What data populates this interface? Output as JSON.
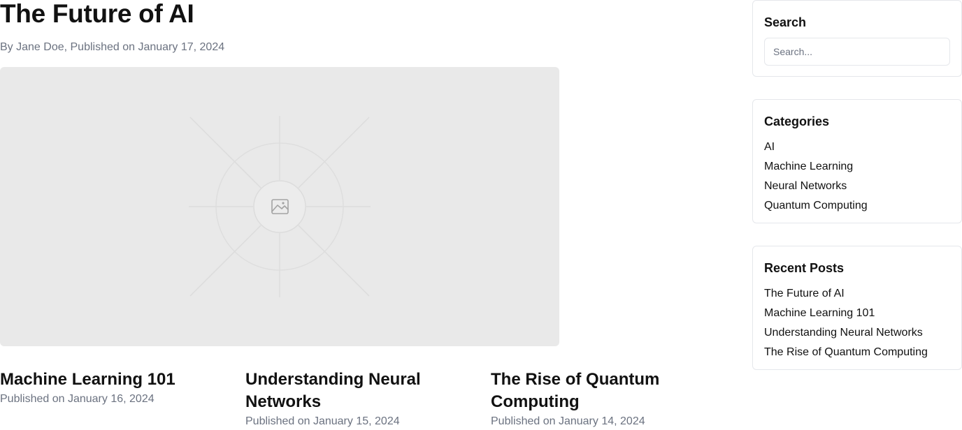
{
  "post": {
    "title": "The Future of AI",
    "byline": "By Jane Doe, Published on January 17, 2024",
    "image_icon": "image-placeholder-icon"
  },
  "related_posts": [
    {
      "title": "Machine Learning 101",
      "date": "Published on January 16, 2024"
    },
    {
      "title": "Understanding Neural Networks",
      "date": "Published on January 15, 2024"
    },
    {
      "title": "The Rise of Quantum Computing",
      "date": "Published on January 14, 2024"
    }
  ],
  "sidebar": {
    "search": {
      "title": "Search",
      "placeholder": "Search..."
    },
    "categories": {
      "title": "Categories",
      "items": [
        "AI",
        "Machine Learning",
        "Neural Networks",
        "Quantum Computing"
      ]
    },
    "recent": {
      "title": "Recent Posts",
      "items": [
        "The Future of AI",
        "Machine Learning 101",
        "Understanding Neural Networks",
        "The Rise of Quantum Computing"
      ]
    }
  }
}
